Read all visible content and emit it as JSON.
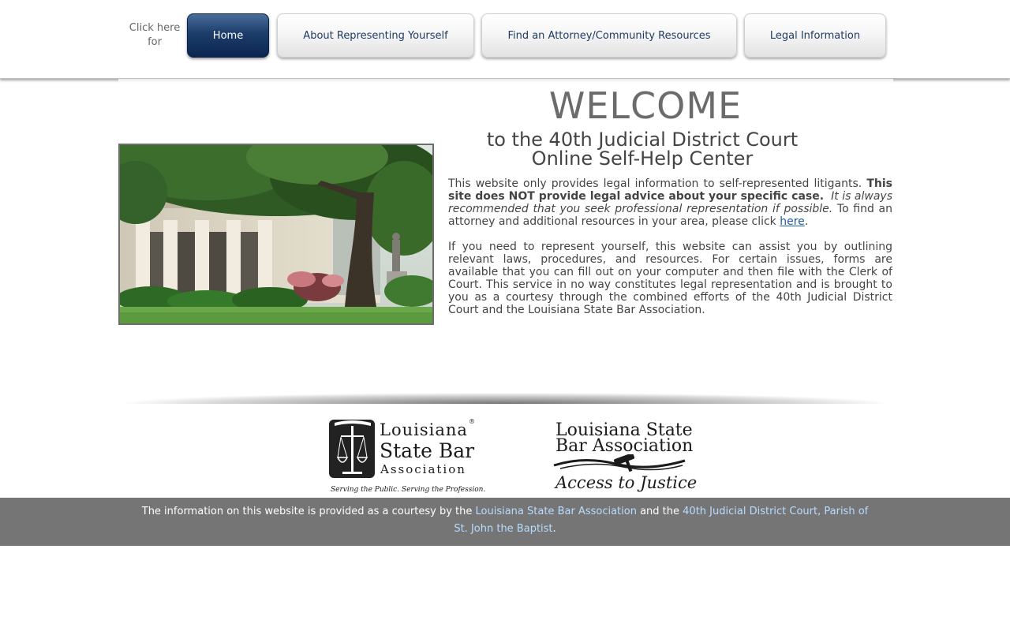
{
  "header": {
    "click_here": "Click here for",
    "nav": {
      "home": "Home",
      "about": "About Representing Yourself",
      "attorney": "Find an Attorney/Community Resources",
      "legal": "Legal Information"
    }
  },
  "main": {
    "welcome": "WELCOME",
    "subtitle_line1": "to the 40th Judicial District Court",
    "subtitle_line2": "Online Self-Help Center",
    "para1": {
      "text_a": "This website only provides legal information to self-represented litigants. ",
      "bold": "This site does NOT provide legal advice about your specific case.",
      "italic": "It is always recommended that you seek professional representation if possible.",
      "text_b": " To find an attorney and additional resources in your area, please click ",
      "link": "here",
      "end": "."
    },
    "para2": "If you need to represent yourself, this website can assist you by outlining relevant laws, procedures, and resources. For certain issues, forms are available that you can fill out on your computer and then file with the Clerk of Court. This service in no way constitutes legal representation and is brought to you as a courtesy through the combined efforts of the 40th Judicial District Court and the Louisiana State Bar Association."
  },
  "logos": {
    "lsba": {
      "line1": "Louisiana",
      "line2": "State Bar",
      "line3": "Association",
      "reg": "®",
      "tagline": "Serving the Public. Serving the Profession."
    },
    "atj": {
      "line1": "Louisiana State",
      "line2": "Bar Association",
      "line3": "Access to Justice"
    }
  },
  "footer": {
    "text_a": "The information on this website is provided as a courtesy by the ",
    "link1": "Louisiana State Bar Association",
    "text_b": " and the ",
    "link2": "40th Judicial District Court, Parish of St. John the Baptist",
    "end": "."
  },
  "colors": {
    "nav_active": "#0b2550",
    "nav_text": "#1f3b63",
    "footer_bg": "#757575",
    "link": "#1f5ea8",
    "footer_link": "#b8dcff"
  }
}
